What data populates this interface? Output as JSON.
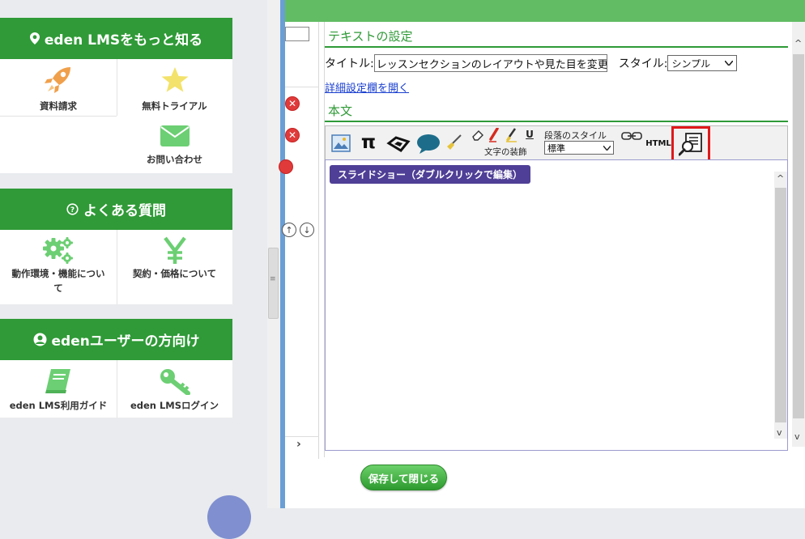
{
  "sidebar": {
    "learn_more": {
      "title": "eden LMSをもっと知る",
      "items": [
        {
          "label": "資料請求",
          "icon": "rocket-icon"
        },
        {
          "label": "無料トライアル",
          "icon": "star-icon"
        },
        {
          "label": "お問い合わせ",
          "icon": "envelope-icon"
        }
      ]
    },
    "faq": {
      "title": "よくある質問",
      "items": [
        {
          "label_line1": "動作環境・機能につい",
          "label_line2": "て",
          "icon": "gears-icon"
        },
        {
          "label": "契約・価格について",
          "icon": "yen-icon"
        }
      ]
    },
    "users": {
      "title": "edenユーザーの方向け",
      "items": [
        {
          "label": "eden LMS利用ガイド",
          "icon": "book-icon"
        },
        {
          "label": "eden LMSログイン",
          "icon": "key-icon"
        }
      ]
    }
  },
  "editor": {
    "text_settings_title": "テキストの設定",
    "title_label": "タイトル:",
    "title_value": "レッスンセクションのレイアウトや見た目を変更で",
    "style_label": "スタイル:",
    "style_value": "シンプル",
    "advanced_link": "詳細設定欄を開く",
    "body_title": "本文",
    "toolbar": {
      "para_style_label": "段落のスタイル",
      "para_style_value": "標準",
      "deco_label": "文字の装飾",
      "html_label": "HTML",
      "pi_symbol": "π",
      "underline_letter": "U"
    },
    "slideshow_chip": "スライドショー（ダブルクリックで編集）",
    "save_button": "保存して閉じる"
  },
  "colors": {
    "green": "#2f9a37",
    "highlight": "#e0191b",
    "chip": "#4f3f96"
  }
}
